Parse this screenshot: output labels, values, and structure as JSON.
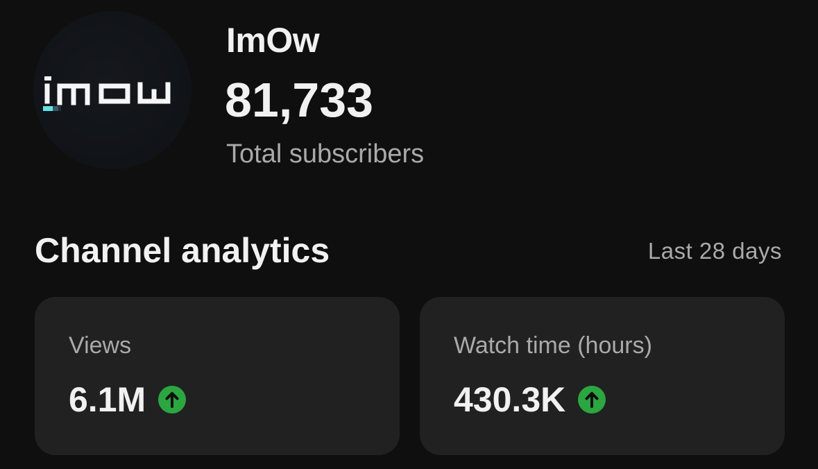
{
  "channel": {
    "name": "ImOw",
    "subscriber_count": "81,733",
    "subscriber_label": "Total subscribers",
    "avatar_logo_text": "imow",
    "avatar_icon": "channel-logo-icon"
  },
  "analytics": {
    "title": "Channel analytics",
    "period": "Last 28 days",
    "cards": [
      {
        "label": "Views",
        "value": "6.1M",
        "trend_icon": "arrow-up-icon",
        "trend_color": "#2ba640"
      },
      {
        "label": "Watch time (hours)",
        "value": "430.3K",
        "trend_icon": "arrow-up-icon",
        "trend_color": "#2ba640"
      }
    ]
  },
  "colors": {
    "background": "#0f0f0f",
    "card_background": "#212121",
    "primary_text": "#f1f1f1",
    "secondary_text": "#aaaaaa",
    "trend_up": "#2ba640",
    "logo_accent": "#5fe3e6"
  }
}
